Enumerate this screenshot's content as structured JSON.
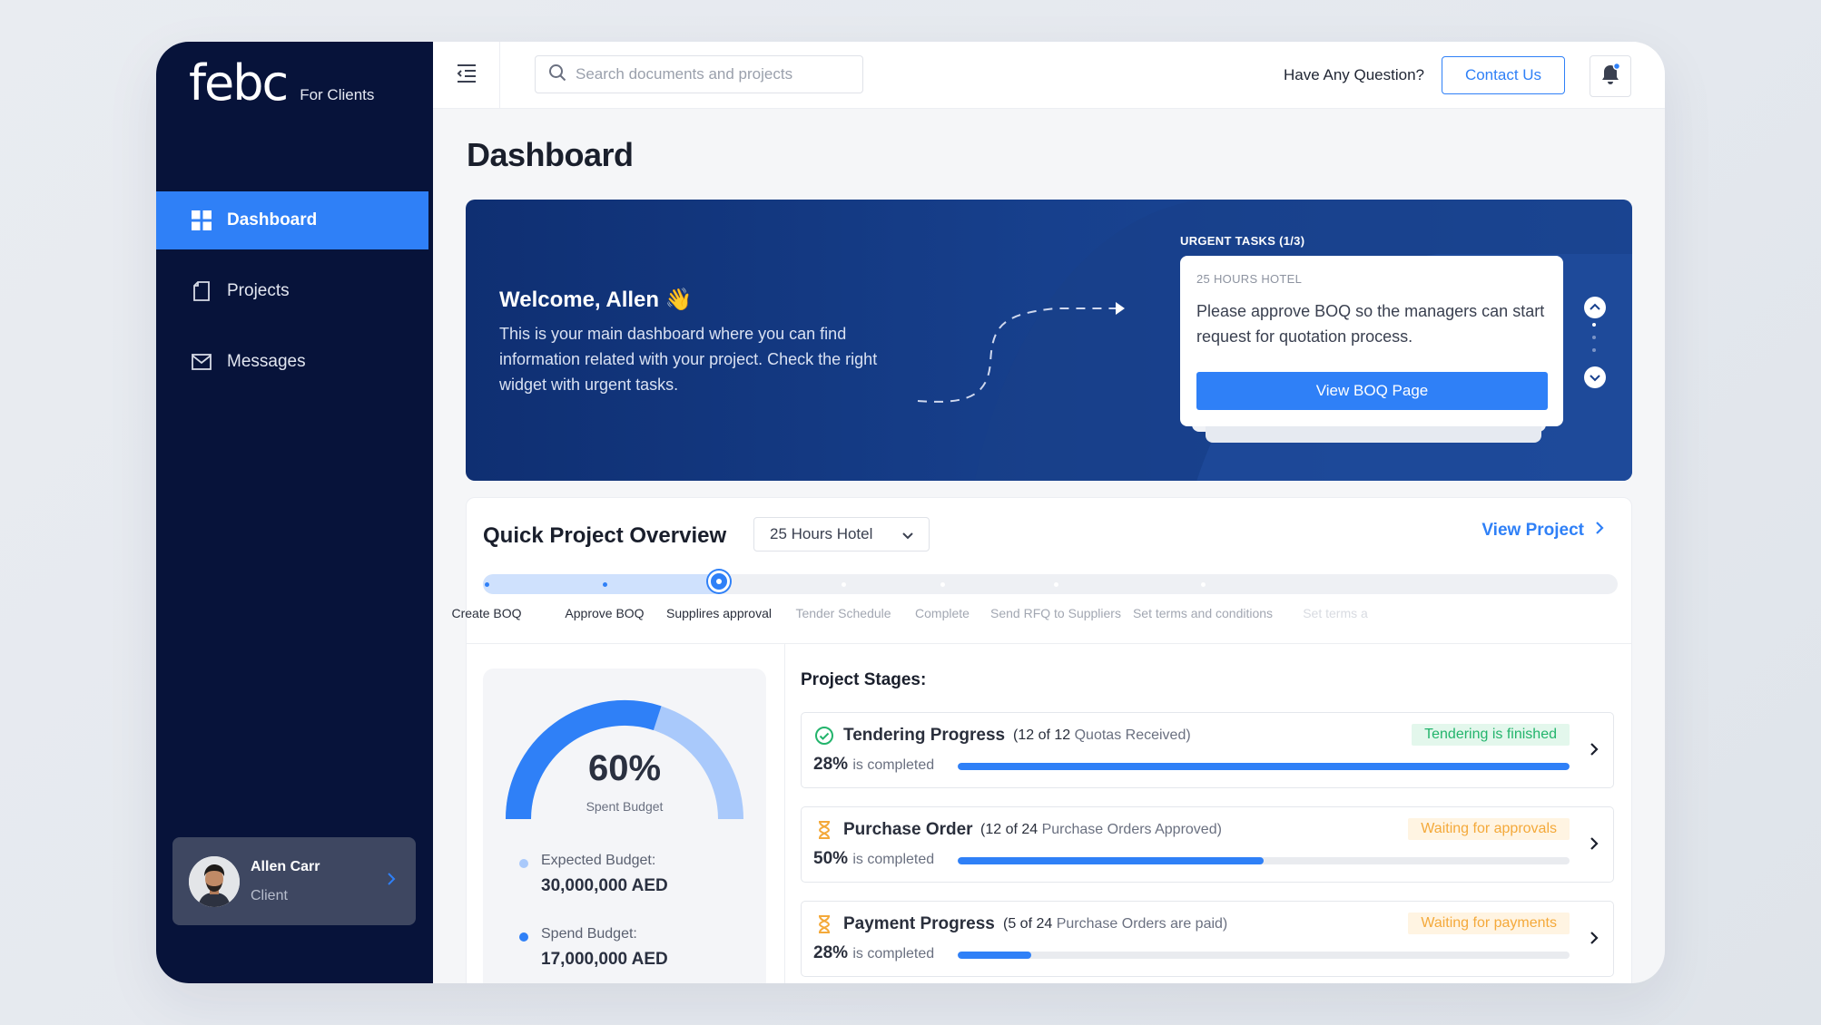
{
  "brand": {
    "logo": "febc",
    "subtitle": "For Clients"
  },
  "sidebar": {
    "items": [
      {
        "label": "Dashboard",
        "icon": "grid-icon",
        "active": true
      },
      {
        "label": "Projects",
        "icon": "document-icon",
        "active": false
      },
      {
        "label": "Messages",
        "icon": "envelope-icon",
        "active": false
      }
    ],
    "user": {
      "name": "Allen Carr",
      "role": "Client"
    }
  },
  "topbar": {
    "search_placeholder": "Search documents and projects",
    "question": "Have Any Question?",
    "contact_label": "Contact Us"
  },
  "page": {
    "title": "Dashboard"
  },
  "hero": {
    "welcome": "Welcome, Allen 👋",
    "text": "This is your main dashboard where you can find information related with your project. Check the right widget with urgent tasks.",
    "urgent_label": "URGENT TASKS (1/3)",
    "task": {
      "project": "25 HOURS HOTEL",
      "description": "Please approve BOQ so the managers can start request for quotation process.",
      "button": "View BOQ Page"
    }
  },
  "overview": {
    "title": "Quick Project Overview",
    "selected_project": "25 Hours Hotel",
    "view_project": "View Project",
    "steps": [
      {
        "label": "Create BOQ",
        "state": "done"
      },
      {
        "label": "Approve BOQ",
        "state": "done"
      },
      {
        "label": "Supplires approval",
        "state": "current"
      },
      {
        "label": "Tender Schedule",
        "state": "todo"
      },
      {
        "label": "Complete",
        "state": "todo"
      },
      {
        "label": "Send RFQ to Suppliers",
        "state": "todo"
      },
      {
        "label": "Set terms and conditions",
        "state": "todo"
      },
      {
        "label": "Set terms a",
        "state": "fade"
      }
    ],
    "budget": {
      "percent": 60,
      "percent_text": "60%",
      "label": "Spent Budget",
      "expected_label": "Expected Budget:",
      "expected_value": "30,000,000 AED",
      "spend_label": "Spend Budget:",
      "spend_value": "17,000,000 AED"
    },
    "stages_title": "Project Stages:",
    "stages": [
      {
        "name": "Tendering Progress",
        "detail_count": "(12 of 12",
        "detail_text": "Quotas Received)",
        "status": "Tendering is finished",
        "status_type": "green",
        "icon": "check-circle-icon",
        "percent": 28,
        "percent_text": "28%",
        "completed_text": "is completed",
        "bar_fill": 1.0
      },
      {
        "name": "Purchase Order",
        "detail_count": "(12 of 24",
        "detail_text": "Purchase Orders Approved)",
        "status": "Waiting for approvals",
        "status_type": "orange",
        "icon": "hourglass-icon",
        "percent": 50,
        "percent_text": "50%",
        "completed_text": "is completed",
        "bar_fill": 0.5
      },
      {
        "name": "Payment Progress",
        "detail_count": "(5 of 24",
        "detail_text": "Purchase Orders are paid)",
        "status": "Waiting for payments",
        "status_type": "orange",
        "icon": "hourglass-icon",
        "percent": 28,
        "percent_text": "28%",
        "completed_text": "is completed",
        "bar_fill": 0.12
      }
    ]
  },
  "colors": {
    "accent": "#2f80f7",
    "sidebar": "#07133a",
    "hero": "#17408d",
    "success": "#23b46c",
    "warning": "#f4a93a"
  }
}
